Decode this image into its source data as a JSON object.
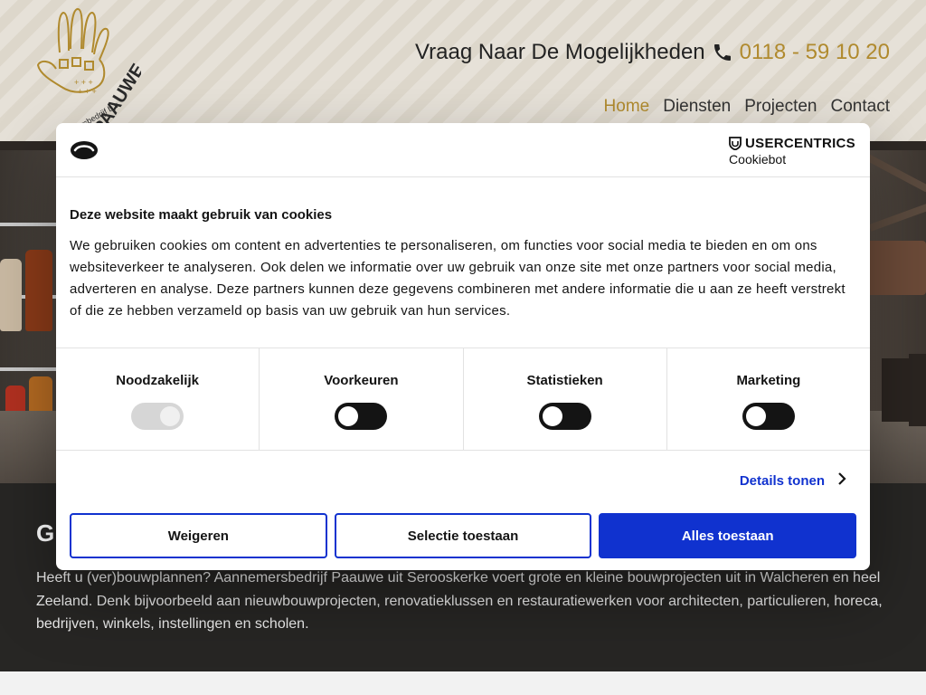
{
  "header": {
    "logo_text": "PAAUWE",
    "logo_subtext": "aannemersbedrijf b.v.",
    "contact_prompt": "Vraag Naar De Mogelijkheden",
    "phone": "0118 - 59 10 20",
    "nav": [
      {
        "label": "Home",
        "active": true
      },
      {
        "label": "Diensten",
        "active": false
      },
      {
        "label": "Projecten",
        "active": false
      },
      {
        "label": "Contact",
        "active": false
      }
    ]
  },
  "intro": {
    "heading_fragment": "G",
    "text": "Heeft u (ver)bouwplannen? Aannemersbedrijf Paauwe uit Serooskerke voert grote en kleine bouwprojecten uit in Walcheren en heel Zeeland. Denk bijvoorbeeld aan nieuwbouwprojecten, renovatieklussen en restauratiewerken voor architecten, particulieren, horeca, bedrijven, winkels, instellingen en scholen."
  },
  "cookie_dialog": {
    "brand_top": "USERCENTRICS",
    "brand_bottom": "Cookiebot",
    "title": "Deze website maakt gebruik van cookies",
    "text": "We gebruiken cookies om content en advertenties te personaliseren, om functies voor social media te bieden en om ons websiteverkeer te analyseren. Ook delen we informatie over uw gebruik van onze site met onze partners voor social media, adverteren en analyse. Deze partners kunnen deze gegevens combineren met andere informatie die u aan ze heeft verstrekt of die ze hebben verzameld op basis van uw gebruik van hun services.",
    "categories": [
      {
        "label": "Noodzakelijk",
        "enabled": true,
        "disabled": true
      },
      {
        "label": "Voorkeuren",
        "enabled": false,
        "disabled": false
      },
      {
        "label": "Statistieken",
        "enabled": false,
        "disabled": false
      },
      {
        "label": "Marketing",
        "enabled": false,
        "disabled": false
      }
    ],
    "details_label": "Details tonen",
    "buttons": {
      "reject": "Weigeren",
      "allow_selection": "Selectie toestaan",
      "allow_all": "Alles toestaan"
    },
    "colors": {
      "accent": "#1032cf",
      "toggle_off": "#141414"
    }
  },
  "colors": {
    "gold": "#b08a2e",
    "dark_section": "#272624"
  }
}
